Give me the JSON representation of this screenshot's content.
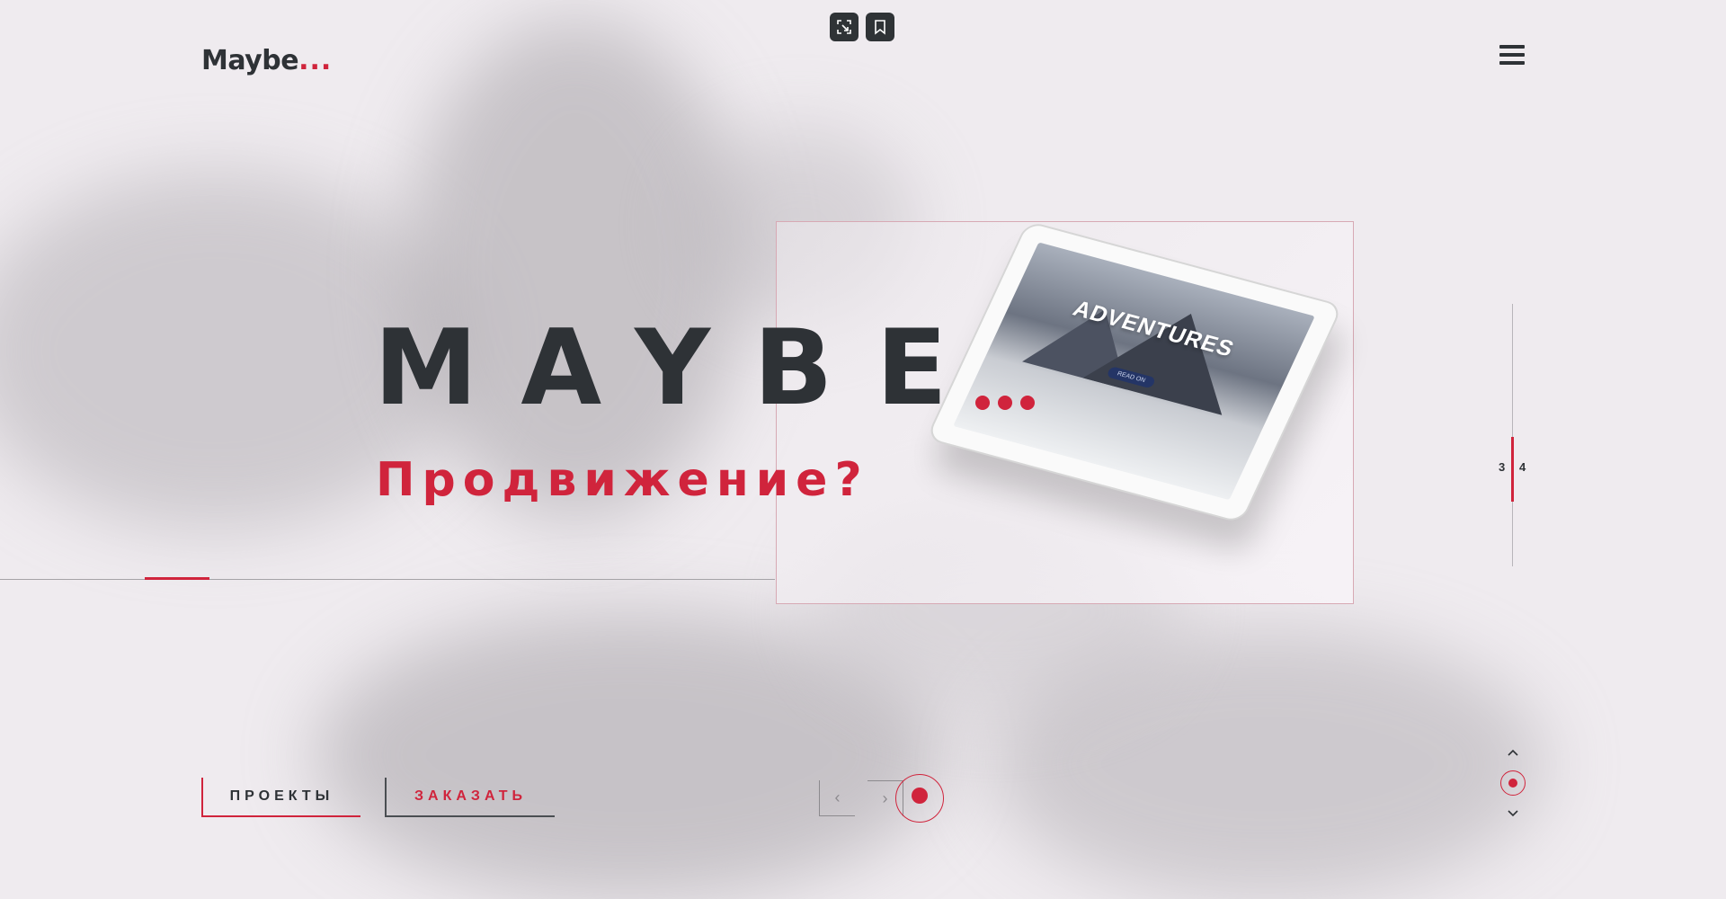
{
  "brand": {
    "logo_text": "Maybe",
    "logo_dots": "..."
  },
  "hero": {
    "title": "MAYBE",
    "subtitle": "Продвижение?"
  },
  "mockup": {
    "screen_title": "ADVENTURES",
    "screen_button": "READ ON"
  },
  "slider": {
    "current": "3",
    "next": "4"
  },
  "actions": {
    "projects_label": "ПРОЕКТЫ",
    "order_label": "ЗАКАЗАТЬ"
  },
  "nav": {
    "prev_symbol": "‹",
    "next_symbol": "›"
  },
  "scroll": {
    "up_symbol": "⌃",
    "down_symbol": "⌄"
  },
  "icons": {
    "top_left": "screenshot-icon",
    "top_right": "bookmark-icon",
    "menu": "hamburger-menu-icon"
  },
  "colors": {
    "accent": "#d0243c",
    "text": "#2e3236",
    "background": "#efebef"
  }
}
